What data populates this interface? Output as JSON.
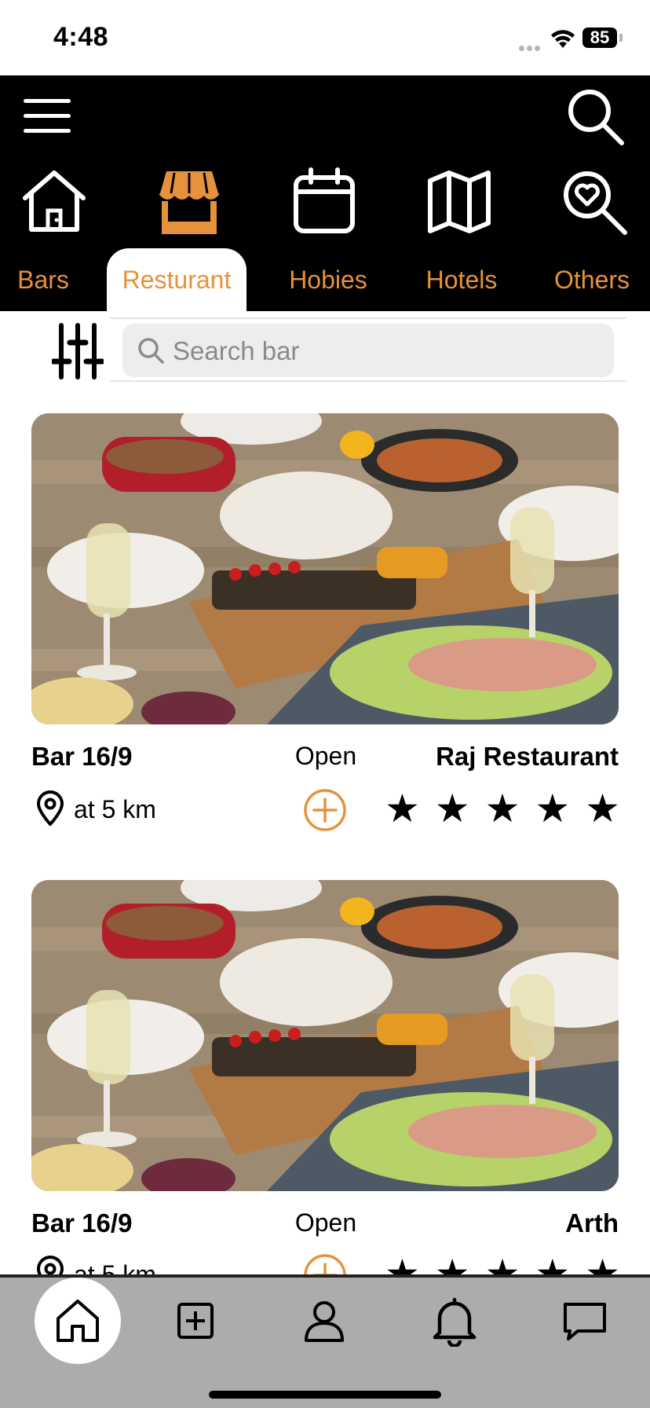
{
  "status_bar": {
    "time": "4:48",
    "battery": "85"
  },
  "header": {
    "menu_icon": "hamburger-menu-icon",
    "search_icon": "search-icon",
    "categories": [
      {
        "icon": "home-icon",
        "label": "Bars"
      },
      {
        "icon": "store-icon",
        "label": "Resturant",
        "active": true
      },
      {
        "icon": "calendar-icon",
        "label": "Hobies"
      },
      {
        "icon": "map-icon",
        "label": "Hotels"
      },
      {
        "icon": "heart-search-icon",
        "label": "Others"
      }
    ]
  },
  "search": {
    "placeholder": "Search bar",
    "value": "",
    "filter_icon": "sliders-icon"
  },
  "listings": [
    {
      "title": "Bar 16/9",
      "status": "Open",
      "name": "Raj Restaurant",
      "distance": "at 5 km",
      "rating": 5
    },
    {
      "title": "Bar 16/9",
      "status": "Open",
      "name": "Arth",
      "distance": "at 5 km",
      "rating": 5
    }
  ],
  "bottom_nav": [
    {
      "icon": "home-icon",
      "active": true
    },
    {
      "icon": "add-square-icon"
    },
    {
      "icon": "profile-icon"
    },
    {
      "icon": "bell-icon"
    },
    {
      "icon": "chat-icon"
    }
  ],
  "colors": {
    "accent": "#e6923a",
    "header_bg": "#000000",
    "nav_bg": "#acacac"
  }
}
